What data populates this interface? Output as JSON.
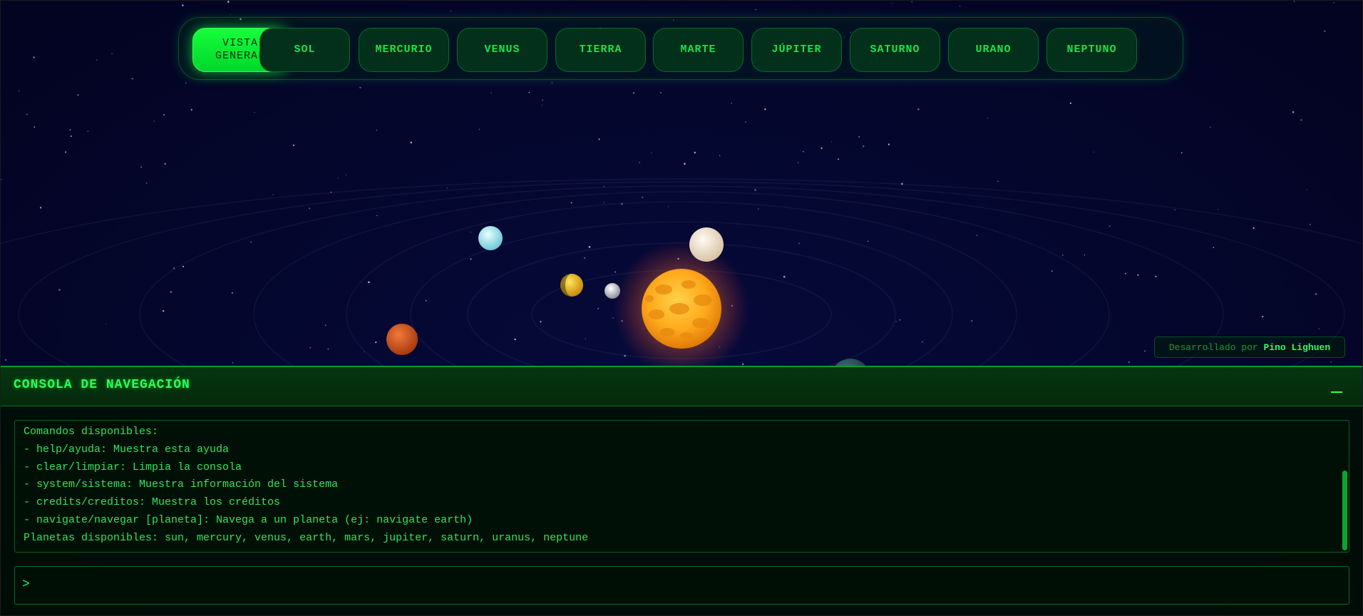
{
  "nav": {
    "items": [
      {
        "label": "VISTA\nGENERAL",
        "active": true
      },
      {
        "label": "SOL",
        "active": false
      },
      {
        "label": "MERCURIO",
        "active": false
      },
      {
        "label": "VENUS",
        "active": false
      },
      {
        "label": "TIERRA",
        "active": false
      },
      {
        "label": "MARTE",
        "active": false
      },
      {
        "label": "JÚPITER",
        "active": false
      },
      {
        "label": "SATURNO",
        "active": false
      },
      {
        "label": "URANO",
        "active": false
      },
      {
        "label": "NEPTUNO",
        "active": false
      }
    ]
  },
  "credits": {
    "prefix": "Desarrollado por ",
    "author": "Pino Lighuen"
  },
  "console": {
    "title": "CONSOLA DE NAVEGACIÓN",
    "lines": [
      "Comandos disponibles:",
      "- help/ayuda: Muestra esta ayuda",
      "- clear/limpiar: Limpia la consola",
      "- system/sistema: Muestra información del sistema",
      "- credits/creditos: Muestra los créditos",
      "- navigate/navegar [planeta]: Navega a un planeta (ej: navigate earth)",
      "Planetas disponibles: sun, mercury, venus, earth, mars, jupiter, saturn, uranus, neptune"
    ],
    "prompt": ">",
    "input_value": ""
  },
  "scene": {
    "bodies": [
      "sun",
      "mercury",
      "venus",
      "earth",
      "mars",
      "jupiter",
      "saturn",
      "uranus",
      "neptune"
    ],
    "colors": {
      "accent": "#00ff33",
      "space": "#04062c",
      "sun": "#ffa51a"
    }
  }
}
